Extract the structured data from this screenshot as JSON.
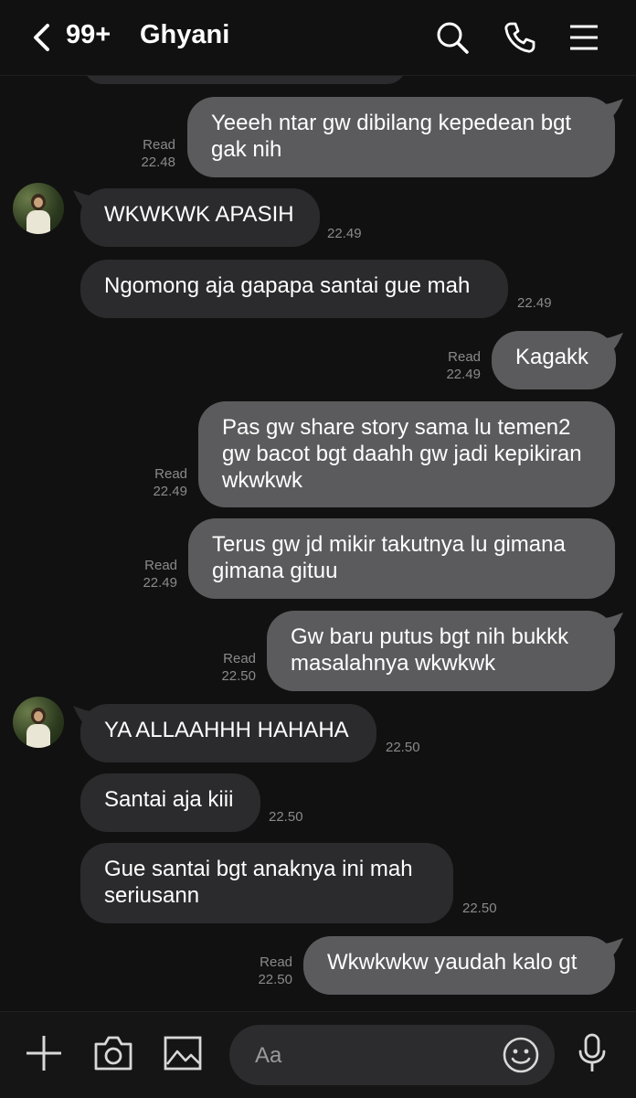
{
  "header": {
    "unread_count": "99+",
    "contact_name": "Ghyani",
    "icons": [
      "chevron-left-icon",
      "search-icon",
      "phone-icon",
      "menu-icon"
    ]
  },
  "messages": [
    {
      "dir": "out",
      "text": "Yeeeh ntar gw dibilang kepedean bgt gak nih",
      "status": "Read",
      "time": "22.48"
    },
    {
      "dir": "in",
      "text": "WKWKWK APASIH",
      "time": "22.49"
    },
    {
      "dir": "in",
      "text": "Ngomong aja gapapa santai gue mah",
      "time": "22.49"
    },
    {
      "dir": "out",
      "text": "Kagakk",
      "status": "Read",
      "time": "22.49"
    },
    {
      "dir": "out",
      "text": "Pas gw share story sama lu temen2 gw bacot bgt daahh gw jadi kepikiran wkwkwk",
      "status": "Read",
      "time": "22.49"
    },
    {
      "dir": "out",
      "text": "Terus gw jd mikir takutnya lu gimana gimana gituu",
      "status": "Read",
      "time": "22.49"
    },
    {
      "dir": "out",
      "text": "Gw baru putus bgt nih bukkk masalahnya wkwkwk",
      "status": "Read",
      "time": "22.50"
    },
    {
      "dir": "in",
      "text": "YA ALLAAHHH HAHAHA",
      "time": "22.50"
    },
    {
      "dir": "in",
      "text": "Santai aja kiii",
      "time": "22.50"
    },
    {
      "dir": "in",
      "text": "Gue santai bgt anaknya ini mah seriusann",
      "time": "22.50"
    },
    {
      "dir": "out",
      "text": "Wkwkwkw yaudah kalo gt",
      "status": "Read",
      "time": "22.50"
    }
  ],
  "composer": {
    "placeholder": "Aa",
    "icons": [
      "plus-icon",
      "camera-icon",
      "image-icon",
      "emoji-icon",
      "microphone-icon"
    ]
  },
  "colors": {
    "background": "#111111",
    "incoming_bubble": "#2b2b2d",
    "outgoing_bubble": "#5b5b5d",
    "meta_text": "#8a8a8a"
  }
}
